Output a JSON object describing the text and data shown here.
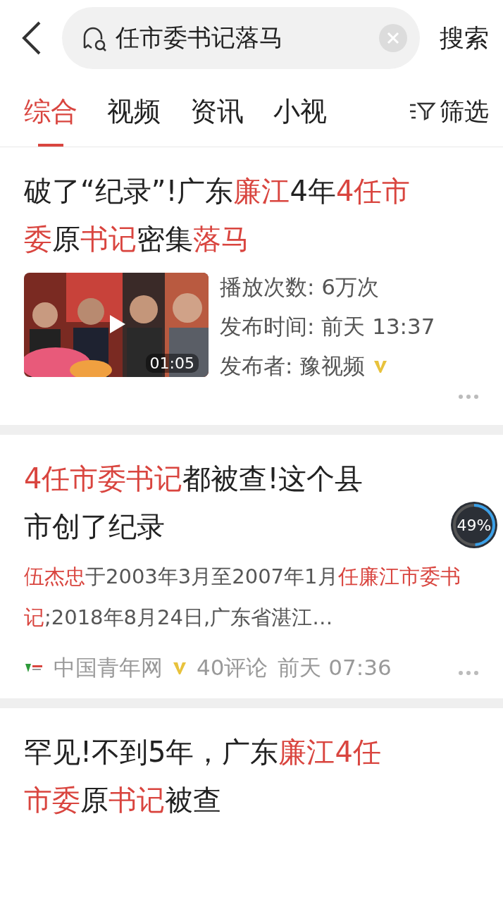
{
  "search": {
    "value": "任市委书记落马",
    "button": "搜索"
  },
  "tabs": [
    {
      "label": "综合",
      "selected": true
    },
    {
      "label": "视频",
      "selected": false
    },
    {
      "label": "资讯",
      "selected": false
    },
    {
      "label": "小视",
      "selected": false
    }
  ],
  "filter": "筛选",
  "results": [
    {
      "kind": "video",
      "title_lines": [
        "破了“纪录”!广东**廉江**4年**4任市**",
        "**委**原**书记**密集**落马**"
      ],
      "thumbnail": {
        "kind": "picture",
        "duration": "01:05"
      },
      "meta": [
        "播放次数: 6万次",
        "发布时间: 前天 13:37",
        "发布者: 豫视频"
      ],
      "verified": true
    },
    {
      "kind": "article",
      "title_lines": [
        "**4任市委书记**都被查!这个县",
        "市创了纪录"
      ],
      "snippet": "**伍杰忠**于2003年3月至2007年1月**任廉江市委书记**;2018年8月24日,广东省湛江…",
      "source": "中国青年网",
      "verified": true,
      "comments": "40评论",
      "time": "前天 07:36"
    },
    {
      "kind": "title",
      "title_lines": [
        "罕见!不到5年，广东**廉江4任**",
        "**市委**原**书记**被查"
      ]
    }
  ],
  "float_ball": {
    "reading": "49%",
    "level": 0.49
  }
}
